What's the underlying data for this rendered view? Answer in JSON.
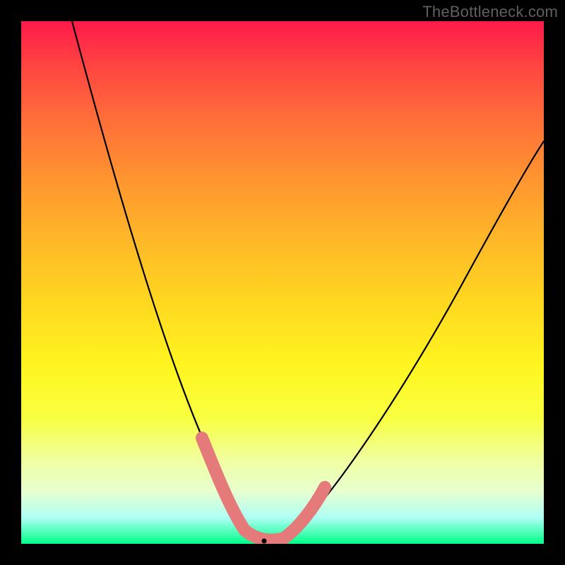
{
  "watermark": "TheBottleneck.com",
  "chart_data": {
    "type": "line",
    "title": "",
    "xlabel": "",
    "ylabel": "",
    "xlim": [
      0,
      100
    ],
    "ylim": [
      0,
      100
    ],
    "grid": false,
    "series": [
      {
        "name": "bottleneck-curve",
        "x": [
          10,
          15,
          20,
          25,
          30,
          35,
          38,
          40,
          42,
          44,
          46,
          48,
          50,
          55,
          60,
          65,
          70,
          75,
          80,
          85,
          90,
          95,
          100
        ],
        "values": [
          100,
          80,
          62,
          46,
          32,
          18,
          10,
          6,
          3,
          1,
          0,
          0,
          1,
          4,
          9,
          15,
          22,
          29,
          37,
          45,
          54,
          63,
          71
        ]
      }
    ],
    "highlight_segments": [
      {
        "name": "left-accent",
        "x": [
          35,
          40.5
        ],
        "values": [
          18,
          5
        ]
      },
      {
        "name": "right-accent",
        "x": [
          49,
          55
        ],
        "values": [
          1,
          5
        ]
      }
    ],
    "minimum_point": {
      "x": 46,
      "y": 0
    }
  },
  "colors": {
    "curve": "#000000",
    "accent": "#e47a7a",
    "background_top": "#ff1a4a",
    "background_bottom": "#00ff88"
  }
}
